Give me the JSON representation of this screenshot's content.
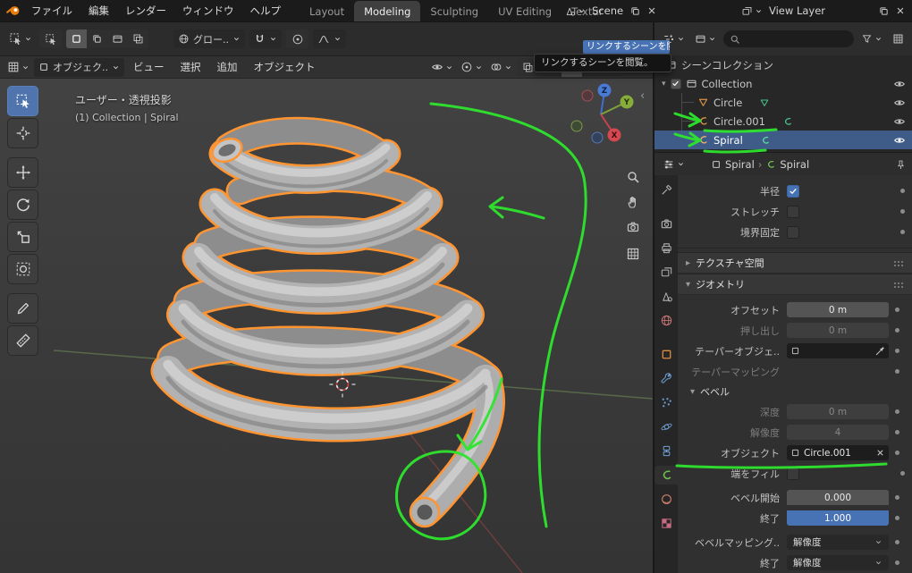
{
  "colors": {
    "accent": "#4772b3",
    "selection_outline": "#ff9430",
    "annotation": "#2ee52e"
  },
  "icons": {
    "logo": "blender-logo",
    "search": "magnifier",
    "visibility": "eye",
    "snap": "magnet",
    "filter": "funnel",
    "zoom": "magnifier-plus",
    "pan": "hand",
    "camera_view": "camera",
    "ortho_toggle": "grid",
    "pin": "pushpin",
    "delete": "x",
    "duplicate": "copy"
  },
  "topbar": {
    "menus": [
      "ファイル",
      "編集",
      "レンダー",
      "ウィンドウ",
      "ヘルプ"
    ],
    "tabs": [
      "Layout",
      "Modeling",
      "Sculpting",
      "UV Editing",
      "Textur"
    ],
    "active_tab": "Modeling",
    "scene": "Scene",
    "view_layer": "View Layer"
  },
  "tool_settings": {
    "orientation": "グロー.."
  },
  "tooltip": {
    "highlight": "リンクするシーンを閲覧",
    "text": "リンクするシーンを閲覧。"
  },
  "viewport": {
    "mode": "オブジェク..",
    "menus": [
      "ビュー",
      "選択",
      "追加",
      "オブジェクト"
    ],
    "view_label": "ユーザー・透視投影",
    "context_label": "(1) Collection | Spiral",
    "axis": {
      "x": "X",
      "y": "Y",
      "z": "Z"
    }
  },
  "outliner": {
    "search_placeholder": "",
    "scene_collection": "シーンコレクション",
    "collection": "Collection",
    "items": [
      "Circle",
      "Circle.001",
      "Spiral"
    ],
    "selected_item": "Spiral"
  },
  "properties": {
    "breadcrumb_object": "Spiral",
    "breadcrumb_separator": "›",
    "breadcrumb_data": "Spiral",
    "radius_label": "半径",
    "stretch_label": "ストレッチ",
    "bounds_label": "境界固定",
    "texture_space": "テクスチャ空間",
    "geometry": "ジオメトリ",
    "offset_label": "オフセット",
    "offset_value": "0 m",
    "extrude_label": "押し出し",
    "extrude_value": "0 m",
    "taper_object_label": "テーパーオブジェ..",
    "taper_mapping_label": "テーパーマッピング",
    "bevel": "ベベル",
    "depth_label": "深度",
    "depth_value": "0 m",
    "resolution_label": "解像度",
    "resolution_value": "4",
    "object_label": "オブジェクト",
    "object_value": "Circle.001",
    "fill_caps_label": "端をフィル",
    "start_label": "ベベル開始",
    "start_value": "0.000",
    "end_label": "終了",
    "end_value": "1.000",
    "bevel_mapping_label": "ベベルマッピング..",
    "bevel_mapping_value": "解像度",
    "mapping_end_label": "終了",
    "mapping_end_value": "解像度"
  }
}
